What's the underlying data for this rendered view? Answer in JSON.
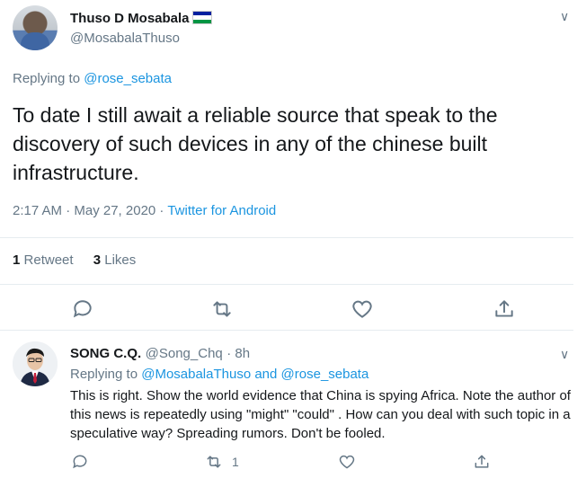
{
  "tweet": {
    "author_name": "Thuso D Mosabala",
    "author_handle": "@MosabalaThuso",
    "replying_prefix": "Replying to",
    "replying_to": "@rose_sebata",
    "text": "To date I still await a reliable source that speak to the discovery of such devices in any of the chinese built infrastructure.",
    "timestamp": "2:17 AM · May 27, 2020 · ",
    "source": "Twitter for Android",
    "retweet_count": "1",
    "retweet_label": "Retweet",
    "likes_count": "3",
    "likes_label": "Likes"
  },
  "reply": {
    "author_name": "SONG C.Q.",
    "author_handle": "@Song_Chq",
    "time": "· 8h",
    "replying_prefix": "Replying to",
    "replying_to": "@MosabalaThuso and @rose_sebata",
    "text": "This is right. Show the world evidence that China is spying Africa. Note the author of this news is repeatedly using \"might\" \"could\" . How can you deal with such topic in a speculative way? Spreading rumors. Don't be fooled.",
    "retweet_count": "1"
  },
  "icons": {
    "chevron": "∨",
    "reply_icon": "reply-icon",
    "retweet_icon": "retweet-icon",
    "like_icon": "heart-icon",
    "share_icon": "share-icon"
  },
  "colors": {
    "link": "#1b95e0",
    "secondary": "#657786",
    "divider": "#e6ecf0"
  }
}
